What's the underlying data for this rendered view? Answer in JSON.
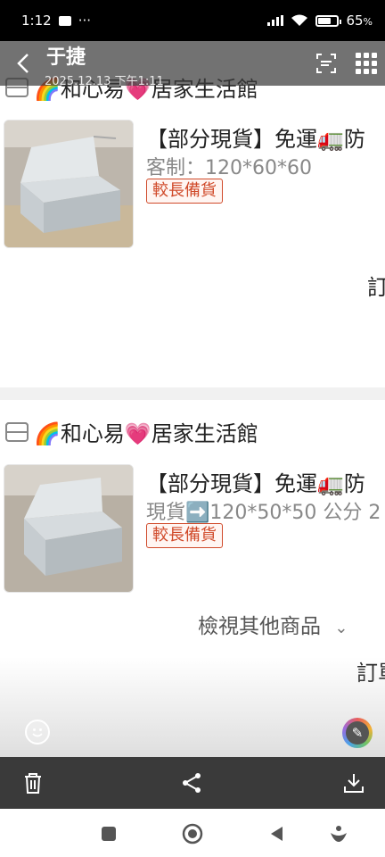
{
  "status_bar": {
    "time": "1:12",
    "dots": "···",
    "battery": "65",
    "battery_unit": "%"
  },
  "viewer": {
    "title": "于捷",
    "date": "2025.12.13 下午1:11",
    "icons": {
      "back": "chevron-left-icon",
      "scan": "scan-icon",
      "grid": "grid-icon"
    }
  },
  "orders": [
    {
      "shop_name": "🌈和心易💗居家生活館",
      "product_title": "【部分現貨】免運🚛防",
      "spec": "客制：120*60*60",
      "badge": "較長備貨",
      "cut_text": "訂"
    },
    {
      "shop_name": "🌈和心易💗居家生活館",
      "product_title": "【部分現貨】免運🚛防",
      "spec": "現貨➡️120*50*50 公分 2",
      "badge": "較長備貨",
      "more_label": "檢視其他商品",
      "cut_text": "訂單"
    }
  ],
  "toolbar": {
    "delete": "trash-icon",
    "share": "share-icon",
    "download": "download-icon"
  },
  "nav": {
    "recents": "square-icon",
    "home": "circle-icon",
    "back": "triangle-back-icon",
    "assistant": "assistant-icon"
  },
  "colors": {
    "badge": "#d04a2a",
    "toolbar": "#3a3a3a",
    "header_overlay": "#3c3c3c"
  }
}
